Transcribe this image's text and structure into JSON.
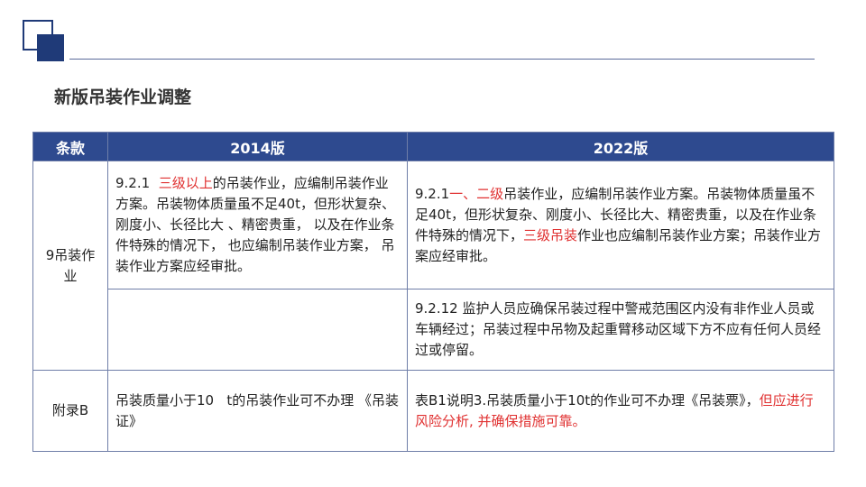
{
  "page": {
    "title": "新版吊装作业调整"
  },
  "table": {
    "headers": [
      "条款",
      "2014版",
      "2022版"
    ],
    "row1": {
      "clause": "9吊装作业",
      "v2014": {
        "prefix": "9.2.1  ",
        "highlight": "三级以上",
        "rest": "的吊装作业，应编制吊装作业方案。吊装物体质量虽不足40t，但形状复杂、刚度小、长径比大 、精密贵重， 以及在作业条件特殊的情况下， 也应编制吊装作业方案，  吊装作业方案应经审批。"
      },
      "v2022": {
        "prefix": "9.2.1",
        "highlight1": "一、二级",
        "mid": "吊装作业，应编制吊装作业方案。吊装物体质量虽不足40t，但形状复杂、刚度小、长径比大、精密贵重，以及在作业条件特殊的情况下，",
        "highlight2": "三级吊装",
        "rest": "作业也应编制吊装作业方案；吊装作业方案应经审批。"
      }
    },
    "row2": {
      "v2022": "9.2.12 监护人员应确保吊装过程中警戒范围区内没有非作业人员或车辆经过；吊装过程中吊物及起重臂移动区域下方不应有任何人员经过或停留。"
    },
    "row3": {
      "clause": "附录B",
      "v2014": "吊装质量小于10   t的吊装作业可不办理 《吊装证》",
      "v2022": {
        "normal": "表B1说明3.吊装质量小于10t的作业可不办理《吊装票》，",
        "highlight": "但应进行风险分析, 并确保措施可靠。"
      }
    }
  },
  "colors": {
    "header_bg": "#2e4a8f",
    "accent_red": "#e03030",
    "brand_navy": "#1f3a78"
  }
}
